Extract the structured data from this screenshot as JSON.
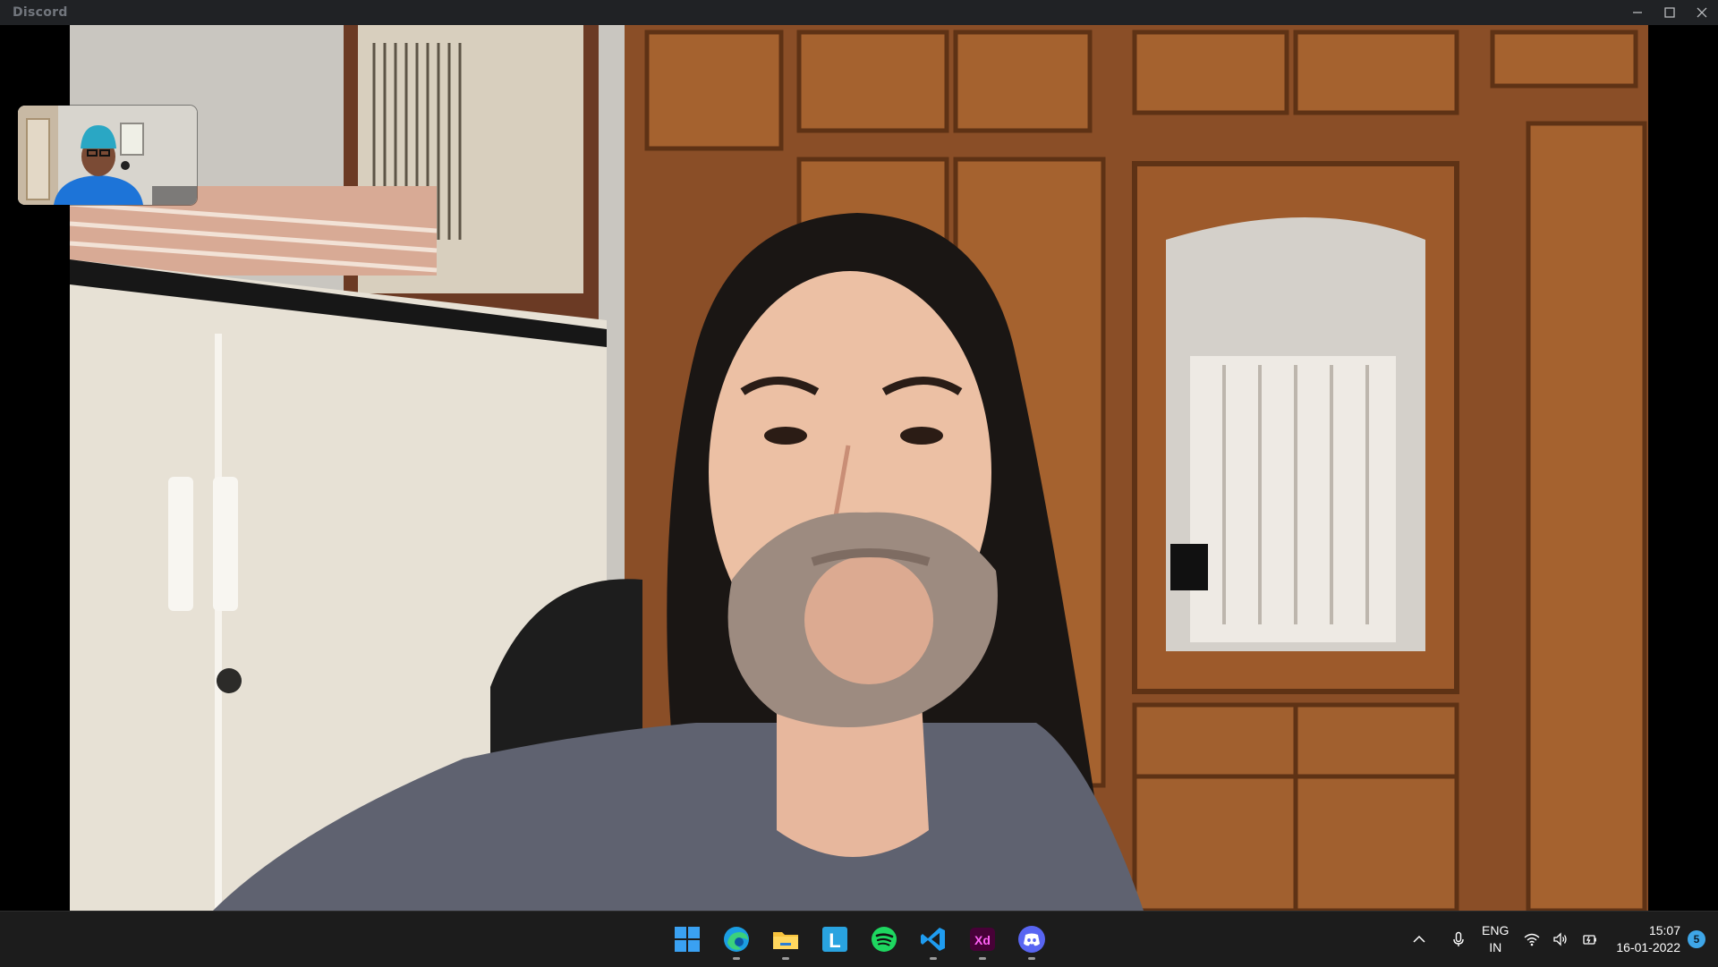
{
  "window": {
    "title": "Discord"
  },
  "stage": {
    "main_participant_icon": "camera-feed",
    "self_view_icon": "camera-feed"
  },
  "taskbar": {
    "apps": [
      {
        "name": "windows-start",
        "running": false
      },
      {
        "name": "microsoft-edge",
        "running": true
      },
      {
        "name": "file-explorer",
        "running": true
      },
      {
        "name": "l-app",
        "running": false
      },
      {
        "name": "spotify",
        "running": false
      },
      {
        "name": "visual-studio-code",
        "running": true
      },
      {
        "name": "adobe-xd",
        "running": true
      },
      {
        "name": "discord",
        "running": true
      }
    ],
    "xd_label": "Xd",
    "l_label": "L",
    "language": {
      "line1": "ENG",
      "line2": "IN"
    },
    "clock": {
      "time": "15:07",
      "date": "16-01-2022"
    },
    "notification_count": "5"
  },
  "colors": {
    "titlebar": "#202225",
    "taskbar": "#1c1c1c",
    "discord_blurple": "#5865f2",
    "spotify_green": "#1ed760",
    "xd_magenta": "#ff61f6",
    "notification": "#3ea6e8"
  }
}
